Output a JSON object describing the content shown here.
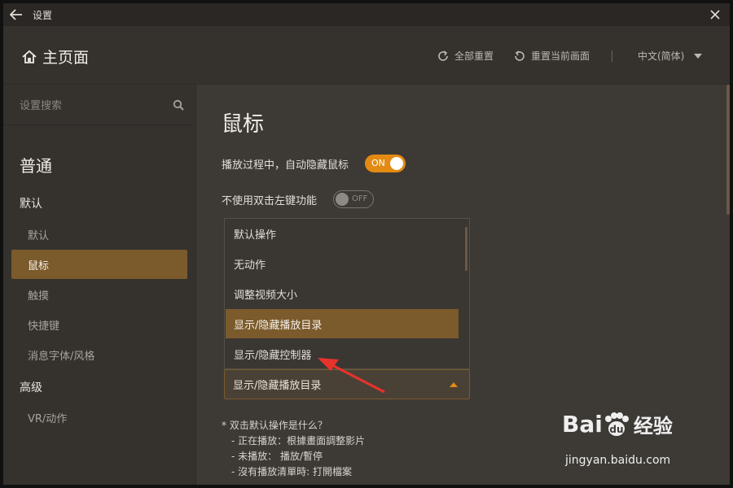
{
  "titlebar": {
    "title": "设置"
  },
  "header": {
    "home_label": "主页面",
    "reset_all": "全部重置",
    "reset_current": "重置当前画面",
    "language": "中文(简体)"
  },
  "sidebar": {
    "search_placeholder": "设置搜索",
    "group": "普通",
    "categories": [
      "默认",
      "高级"
    ],
    "items": [
      {
        "label": "默认",
        "active": false
      },
      {
        "label": "鼠标",
        "active": true
      },
      {
        "label": "触摸",
        "active": false
      },
      {
        "label": "快捷键",
        "active": false
      },
      {
        "label": "消息字体/风格",
        "active": false
      }
    ],
    "advanced_items": [
      {
        "label": "VR/动作"
      }
    ]
  },
  "main": {
    "title": "鼠标",
    "settings": [
      {
        "label": "播放过程中，自动隐藏鼠标",
        "toggle": "ON",
        "state": true
      },
      {
        "label": "不使用双击左键功能",
        "toggle": "OFF",
        "state": false
      }
    ],
    "dropdown": {
      "options": [
        "默认操作",
        "无动作",
        "调整视频大小",
        "显示/隐藏播放目录",
        "显示/隐藏控制器"
      ],
      "highlighted": "显示/隐藏播放目录",
      "selected": "显示/隐藏播放目录"
    },
    "note": {
      "question": "* 双击默认操作是什么？",
      "lines": [
        "- 正在播放：根據畫面調整影片",
        "- 未播放： 播放/暫停",
        "- 沒有播放清單時: 打開檔案"
      ]
    }
  },
  "watermark": {
    "brand": "Bai",
    "brand_suffix": "经验",
    "url": "jingyan.baidu.com"
  },
  "colors": {
    "accent": "#e38a12",
    "selection": "#7b5a2c",
    "background": "#3d3a36",
    "arrow": "#e8322c"
  }
}
